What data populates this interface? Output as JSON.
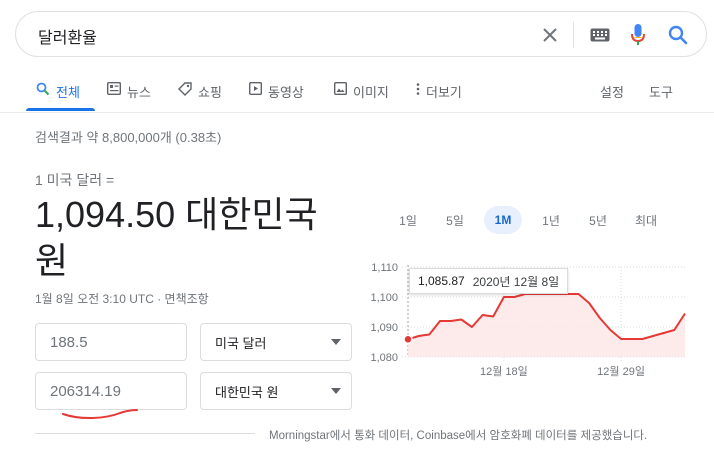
{
  "search": {
    "query": "달러환율"
  },
  "tabs": [
    {
      "label": "전체",
      "icon": "search-icon"
    },
    {
      "label": "뉴스",
      "icon": "news-icon"
    },
    {
      "label": "쇼핑",
      "icon": "tag-icon"
    },
    {
      "label": "동영상",
      "icon": "video-icon"
    },
    {
      "label": "이미지",
      "icon": "image-icon"
    },
    {
      "label": "더보기",
      "icon": "more-vert-icon"
    }
  ],
  "tools": {
    "settings": "설정",
    "tools": "도구"
  },
  "results_stats": "검색결과 약 8,800,000개 (0.38초)",
  "converter": {
    "from_text": "1 미국 달러 =",
    "result_text": "1,094.50 대한민국 원",
    "timestamp": "1월 8일 오전 3:10 UTC · 면책조항",
    "amount_from": "188.5",
    "amount_to": "206314.19",
    "currency_from": "미국 달러",
    "currency_to": "대한민국 원"
  },
  "chart_ranges": [
    "1일",
    "5일",
    "1M",
    "1년",
    "5년",
    "최대"
  ],
  "active_range": "1M",
  "tooltip": {
    "value": "1,085.87",
    "date": "2020년 12월 8일"
  },
  "footer_note": "Morningstar에서 통화 데이터, Coinbase에서 암호화폐 데이터를 제공했습니다.",
  "colors": {
    "accent": "#1a73e8",
    "line": "#e53935",
    "fill": "#fce8e6"
  },
  "chart_data": {
    "type": "area",
    "x_ticks": [
      "12월 18일",
      "12월 29일"
    ],
    "y_ticks": [
      1080,
      1090,
      1100,
      1110
    ],
    "ylim": [
      1080,
      1110
    ],
    "y_tick_labels": [
      "1,080",
      "1,090",
      "1,100",
      "1,110"
    ],
    "highlight_index": 0,
    "values": [
      1085.9,
      1087.0,
      1087.5,
      1092.0,
      1092.0,
      1092.5,
      1090.0,
      1094.0,
      1093.5,
      1100.0,
      1100.0,
      1101.0,
      1101.0,
      1101.0,
      1101.0,
      1101.0,
      1101.0,
      1098.0,
      1093.0,
      1089.0,
      1086.0,
      1086.0,
      1086.0,
      1087.0,
      1088.0,
      1089.0,
      1094.5
    ]
  }
}
